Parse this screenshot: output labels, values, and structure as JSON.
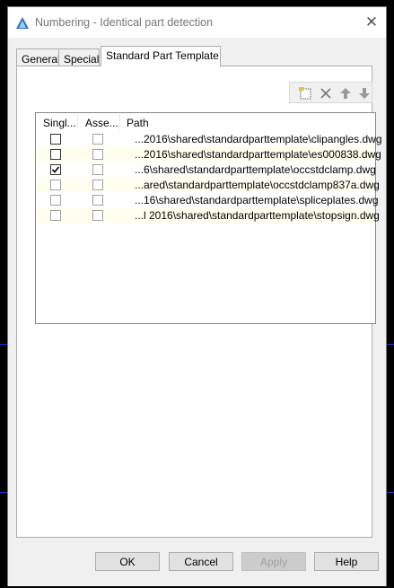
{
  "window": {
    "title": "Numbering - Identical part detection",
    "close_glyph": "✕"
  },
  "tabs": [
    {
      "label": "General",
      "active": false
    },
    {
      "label": "Special",
      "active": false
    },
    {
      "label": "Standard Part Template",
      "active": true
    }
  ],
  "toolbar": {
    "icons": [
      "new-template-icon",
      "delete-icon",
      "move-up-icon",
      "move-down-icon"
    ]
  },
  "list": {
    "columns": [
      "Singl...",
      "Asse...",
      "Path"
    ],
    "rows": [
      {
        "single": false,
        "assembly": false,
        "single_dim": false,
        "path": "...2016\\shared\\standardparttemplate\\clipangles.dwg"
      },
      {
        "single": false,
        "assembly": false,
        "single_dim": false,
        "path": "...2016\\shared\\standardparttemplate\\es000838.dwg"
      },
      {
        "single": true,
        "assembly": false,
        "single_dim": false,
        "path": "...6\\shared\\standardparttemplate\\occstdclamp.dwg"
      },
      {
        "single": false,
        "assembly": false,
        "single_dim": true,
        "path": "...ared\\standardparttemplate\\occstdclamp837a.dwg"
      },
      {
        "single": false,
        "assembly": false,
        "single_dim": true,
        "path": "...16\\shared\\standardparttemplate\\spliceplates.dwg"
      },
      {
        "single": false,
        "assembly": false,
        "single_dim": true,
        "path": "...l 2016\\shared\\standardparttemplate\\stopsign.dwg"
      }
    ]
  },
  "buttons": {
    "ok": "OK",
    "cancel": "Cancel",
    "apply": "Apply",
    "help": "Help"
  },
  "colors": {
    "accent": "#1e3ad8",
    "row_alt": "#fffff0"
  }
}
